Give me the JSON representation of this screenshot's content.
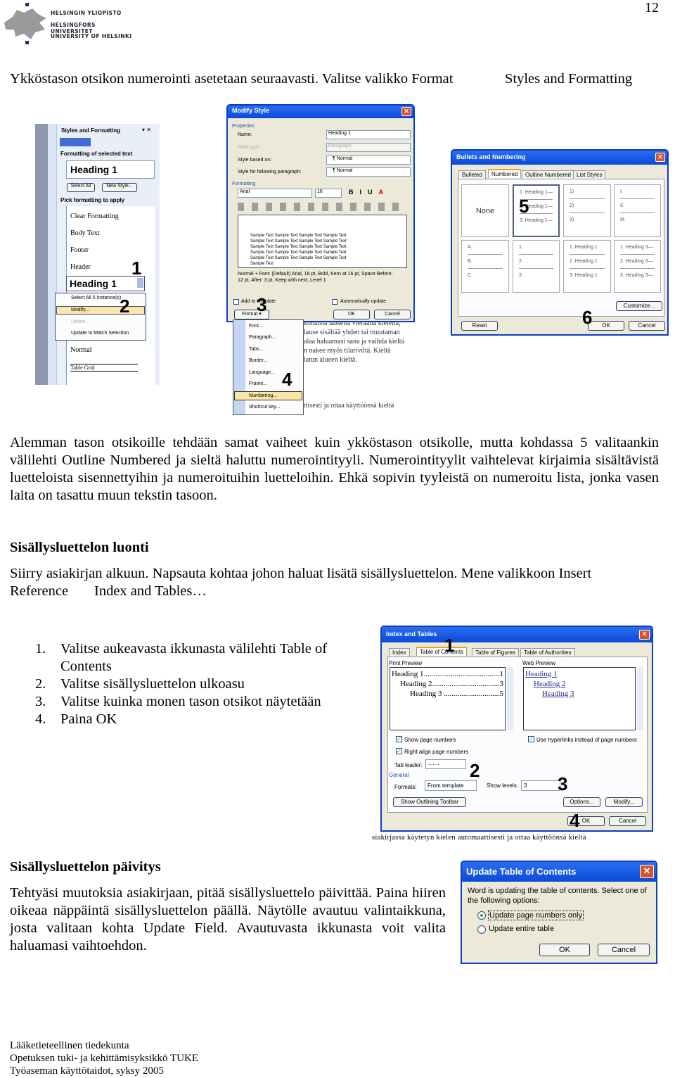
{
  "header": {
    "logo_lines": [
      "HELSINGIN YLIOPISTO",
      "HELSINGFORS UNIVERSITET",
      "UNIVERSITY OF HELSINKI"
    ],
    "page_number": "12"
  },
  "intro": {
    "text": "Ykköstason otsikon numerointi asetetaan seuraavasti. Valitse valikko Format",
    "menu_path": "Styles and Formatting"
  },
  "styles_panel": {
    "title": "Styles and Formatting",
    "selected_label": "Formatting of selected text",
    "selected_style": "Heading 1",
    "select_all": "Select All",
    "new_style": "New Style...",
    "pick_label": "Pick formatting to apply",
    "styles": [
      "Clear Formatting",
      "Body Text",
      "Footer",
      "Header"
    ],
    "active_style": "Heading 1",
    "context_menu": [
      "Select All 5 Instance(s)",
      "Modify...",
      "Delete...",
      "Update to Match Selection"
    ],
    "styles_after": [
      "Normal",
      "Table Grid"
    ],
    "markers": [
      "1",
      "2"
    ]
  },
  "modify_style": {
    "title": "Modify Style",
    "properties": "Properties",
    "fields": [
      {
        "label": "Name:",
        "value": "Heading 1"
      },
      {
        "label": "Style type:",
        "value": "Paragraph"
      },
      {
        "label": "Style based on:",
        "value": "¶ Normal"
      },
      {
        "label": "Style for following paragraph:",
        "value": "¶ Normal"
      }
    ],
    "formatting": "Formatting",
    "font": "Arial",
    "size": "16",
    "sample": "Sample Text Sample Text Sample Text Sample Text",
    "sample_end": "Sample Text",
    "description": "Normal + Font: (Default) Arial, 16 pt, Bold, Kern at 16 pt, Space Before: 12 pt, After: 3 pt, Keep with next, Level 1",
    "add_to_template": "Add to template",
    "auto_update": "Automatically update",
    "format_button": "Format ▾",
    "ok": "OK",
    "cancel": "Cancel",
    "format_menu": [
      "Font...",
      "Paragraph...",
      "Tabs...",
      "Border...",
      "Language...",
      "Frame...",
      "Numbering...",
      "Shortcut key..."
    ],
    "markers": [
      "3",
      "4"
    ],
    "bg_text": [
      "konaisia lauseita vieraalla kielellä,",
      "lause sisältää yhden tai muutaman",
      "alaa haluamasi sana ja vaihda kieltä",
      "n nakee myös tilariviltä. Kieltä",
      "latun alueen kieltä.",
      "ttisesti ja ottaa käyttöönsä kieltä"
    ]
  },
  "bullets": {
    "title": "Bullets and Numbering",
    "tabs": [
      "Bulleted",
      "Numbered",
      "Outline Numbered",
      "List Styles"
    ],
    "active_tab": 1,
    "none": "None",
    "row1": [
      [
        "1. Heading 1—",
        "2. Heading 1—",
        "3. Heading 1—"
      ],
      [
        "1)",
        "2)",
        "3)"
      ],
      [
        "I.",
        "II.",
        "III."
      ]
    ],
    "row2": [
      [
        "A.",
        "B.",
        "C."
      ],
      [
        "1.",
        "2.",
        "3."
      ],
      [
        "1. Heading 1",
        "2. Heading 1",
        "3. Heading 1"
      ],
      [
        "1. Heading 3—",
        "2. Heading 3—",
        "3. Heading 3—"
      ]
    ],
    "customize": "Customize...",
    "reset": "Reset",
    "ok": "OK",
    "cancel": "Cancel",
    "markers": [
      "5",
      "6"
    ]
  },
  "para1": "Alemman tason otsikoille tehdään samat vaiheet kuin ykköstason otsikolle, mutta kohdassa 5 valitaankin välilehti Outline Numbered ja sieltä haluttu numerointityyli. Numerointityylit vaihtelevat kirjaimia sisältävistä luetteloista sisennettyihin ja numeroituihin luetteloihin. Ehkä sopivin tyyleistä on numeroitu lista, jonka vasen laita on tasattu muun tekstin tasoon.",
  "section1": {
    "heading": "Sisällysluettelon luonti",
    "text": "Siirry asiakirjan alkuun. Napsauta kohtaa johon haluat lisätä sisällysluettelon. Mene valikkoon Insert",
    "text2a": "Reference",
    "text2b": "Index and Tables…",
    "steps": [
      "Valitse aukeavasta ikkunasta välilehti Table of Contents",
      "Valitse sisällysluettelon ulkoasu",
      "Valitse kuinka monen tason otsikot näytetään",
      "Paina OK"
    ]
  },
  "index_tables": {
    "title": "Index and Tables",
    "tabs": [
      "Index",
      "Table of Contents",
      "Table of Figures",
      "Table of Authorities"
    ],
    "active_tab": 1,
    "print_preview": "Print Preview",
    "web_preview": "Web Preview",
    "headings": [
      {
        "text": "Heading 1",
        "page": "1"
      },
      {
        "text": "Heading 2",
        "page": "3"
      },
      {
        "text": "Heading 3",
        "page": "5"
      }
    ],
    "show_page_numbers": "Show page numbers",
    "right_align": "Right align page numbers",
    "use_hyperlinks": "Use hyperlinks instead of page numbers",
    "tab_leader_label": "Tab leader:",
    "tab_leader": ".......",
    "general": "General",
    "formats_label": "Formats:",
    "formats": "From template",
    "show_levels_label": "Show levels:",
    "show_levels": "3",
    "outlining": "Show Outlining Toolbar",
    "options": "Options...",
    "modify": "Modify...",
    "ok": "OK",
    "cancel": "Cancel",
    "markers": [
      "1",
      "2",
      "3",
      "4"
    ],
    "below_text": "siakirjassa käytetyn kielen automaattisesti ja ottaa käyttöönsä kieltä"
  },
  "section2": {
    "heading": "Sisällysluettelon päivitys",
    "text": "Tehtyäsi muutoksia asiakirjaan, pitää sisällysluettelo päivittää. Paina hiiren oikeaa näppäintä sisällysluettelon päällä. Näytölle avautuu valintaikkuna, josta valitaan kohta Update Field. Avautuvasta ikkunasta voit valita haluamasi vaihtoehdon."
  },
  "update_toc": {
    "title": "Update Table of Contents",
    "message": "Word is updating the table of contents.  Select one of the following options:",
    "options": [
      "Update page numbers only",
      "Update entire table"
    ],
    "selected": 0,
    "ok": "OK",
    "cancel": "Cancel"
  },
  "footer": [
    "Lääketieteellinen tiedekunta",
    "Opetuksen tuki- ja kehittämisyksikkö TUKE",
    "Työaseman käyttötaidot, syksy 2005"
  ]
}
